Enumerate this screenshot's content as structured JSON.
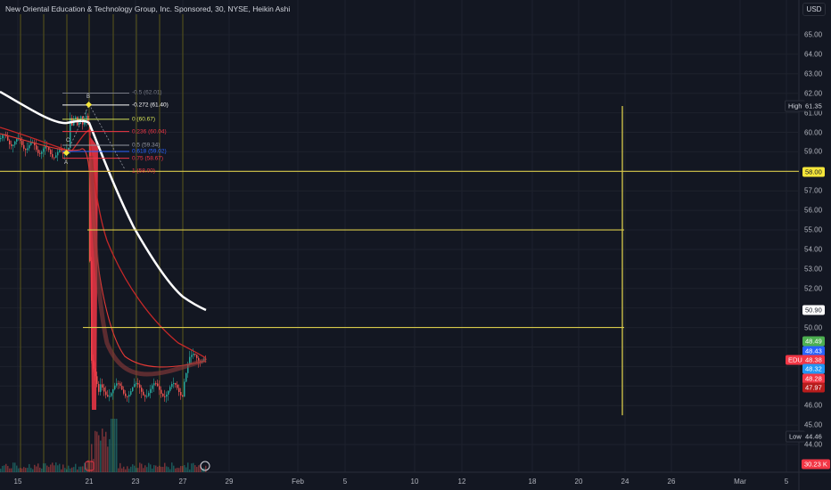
{
  "header": {
    "title": "New Oriental Education & Technology Group, Inc. Sponsored, 30, NYSE, Heikin Ashi",
    "currency": "USD"
  },
  "price_axis": {
    "ticks": [
      "65.00",
      "64.00",
      "63.00",
      "62.00",
      "61.00",
      "60.00",
      "59.00",
      "58.00",
      "57.00",
      "56.00",
      "55.00",
      "54.00",
      "53.00",
      "52.00",
      "51.00",
      "50.00",
      "49.00",
      "48.00",
      "47.00",
      "46.00",
      "45.00",
      "44.00"
    ]
  },
  "time_axis": {
    "ticks": [
      "15",
      "21",
      "23",
      "27",
      "29",
      "Feb",
      "5",
      "10",
      "12",
      "18",
      "20",
      "24",
      "26",
      "Mar",
      "5"
    ]
  },
  "tags": {
    "high_label": "High",
    "high_value": "61.35",
    "level_58": "58.00",
    "ma_value": "50.90",
    "v1": "48.49",
    "v2": "48.43",
    "symbol": "EDU",
    "price": "48.38",
    "v3": "48.32",
    "v4": "48.28",
    "v5": "47.97",
    "low_label": "Low",
    "low_value": "44.46",
    "volume": "30.23 K"
  },
  "fib_levels": [
    {
      "label": "-0.5 (62.01)",
      "color": "#787b86",
      "price": 62.01
    },
    {
      "label": "-0.272 (61.40)",
      "color": "#ffffff",
      "price": 61.4
    },
    {
      "label": "0 (60.67)",
      "color": "#d4e157",
      "price": 60.67
    },
    {
      "label": "0.236 (60.04)",
      "color": "#f23645",
      "price": 60.04
    },
    {
      "label": "0.5 (59.34)",
      "color": "#9598a1",
      "price": 59.34
    },
    {
      "label": "0.618 (59.02)",
      "color": "#2962ff",
      "price": 59.02
    },
    {
      "label": "0.75 (58.67)",
      "color": "#f23645",
      "price": 58.67
    },
    {
      "label": "1 (58.00)",
      "color": "#f23645",
      "price": 58.0
    }
  ],
  "points": {
    "a": "A",
    "b": "B",
    "c": "C"
  },
  "colors": {
    "background": "#131722",
    "grid": "#1e222d",
    "vlines": "#4f4d1c",
    "hlines": "#d8c94a",
    "up": "#26a69a",
    "down": "#ef5350",
    "ma_white": "#ffffff",
    "ma_red": "#c62828"
  }
}
